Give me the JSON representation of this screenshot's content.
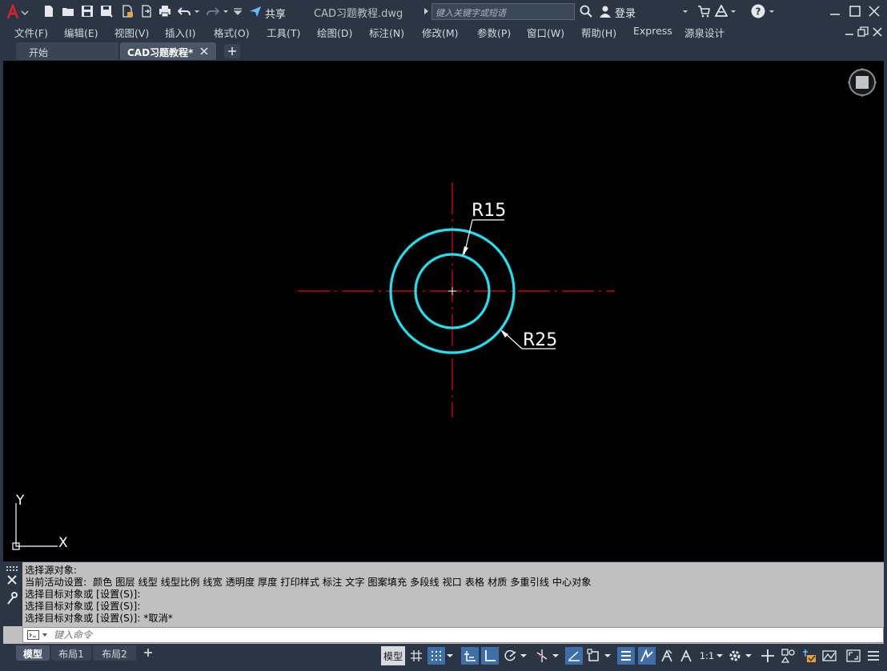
{
  "titlebar": {
    "title": "CAD习题教程.dwg",
    "search_placeholder": "键入关键字或短语",
    "share_label": "共享",
    "login_label": "登录"
  },
  "menu": [
    "文件(F)",
    "编辑(E)",
    "视图(V)",
    "插入(I)",
    "格式(O)",
    "工具(T)",
    "绘图(D)",
    "标注(N)",
    "修改(M)",
    "参数(P)",
    "窗口(W)",
    "帮助(H)",
    "Express",
    "源泉设计"
  ],
  "tabs": [
    "开始",
    "CAD习题教程*"
  ],
  "drawing": {
    "dim_inner": "R15",
    "dim_outer": "R25",
    "ucs_x": "X",
    "ucs_y": "Y",
    "colors": {
      "circle": "#22e0ee",
      "center_line": "#e8001c",
      "dimension": "#ffffff"
    }
  },
  "command": {
    "history": [
      "选择源对象:",
      "当前活动设置:  颜色 图层 线型 线型比例 线宽 透明度 厚度 打印样式 标注 文字 图案填充 多段线 视口 表格 材质 多重引线 中心对象",
      "选择目标对象或 [设置(S)]:",
      "选择目标对象或 [设置(S)]:",
      "选择目标对象或 [设置(S)]: *取消*"
    ],
    "input_placeholder": "键入命令"
  },
  "status": {
    "layout_tabs": [
      "模型",
      "布局1",
      "布局2"
    ],
    "model_label": "模型",
    "scale_label": "1:1"
  }
}
